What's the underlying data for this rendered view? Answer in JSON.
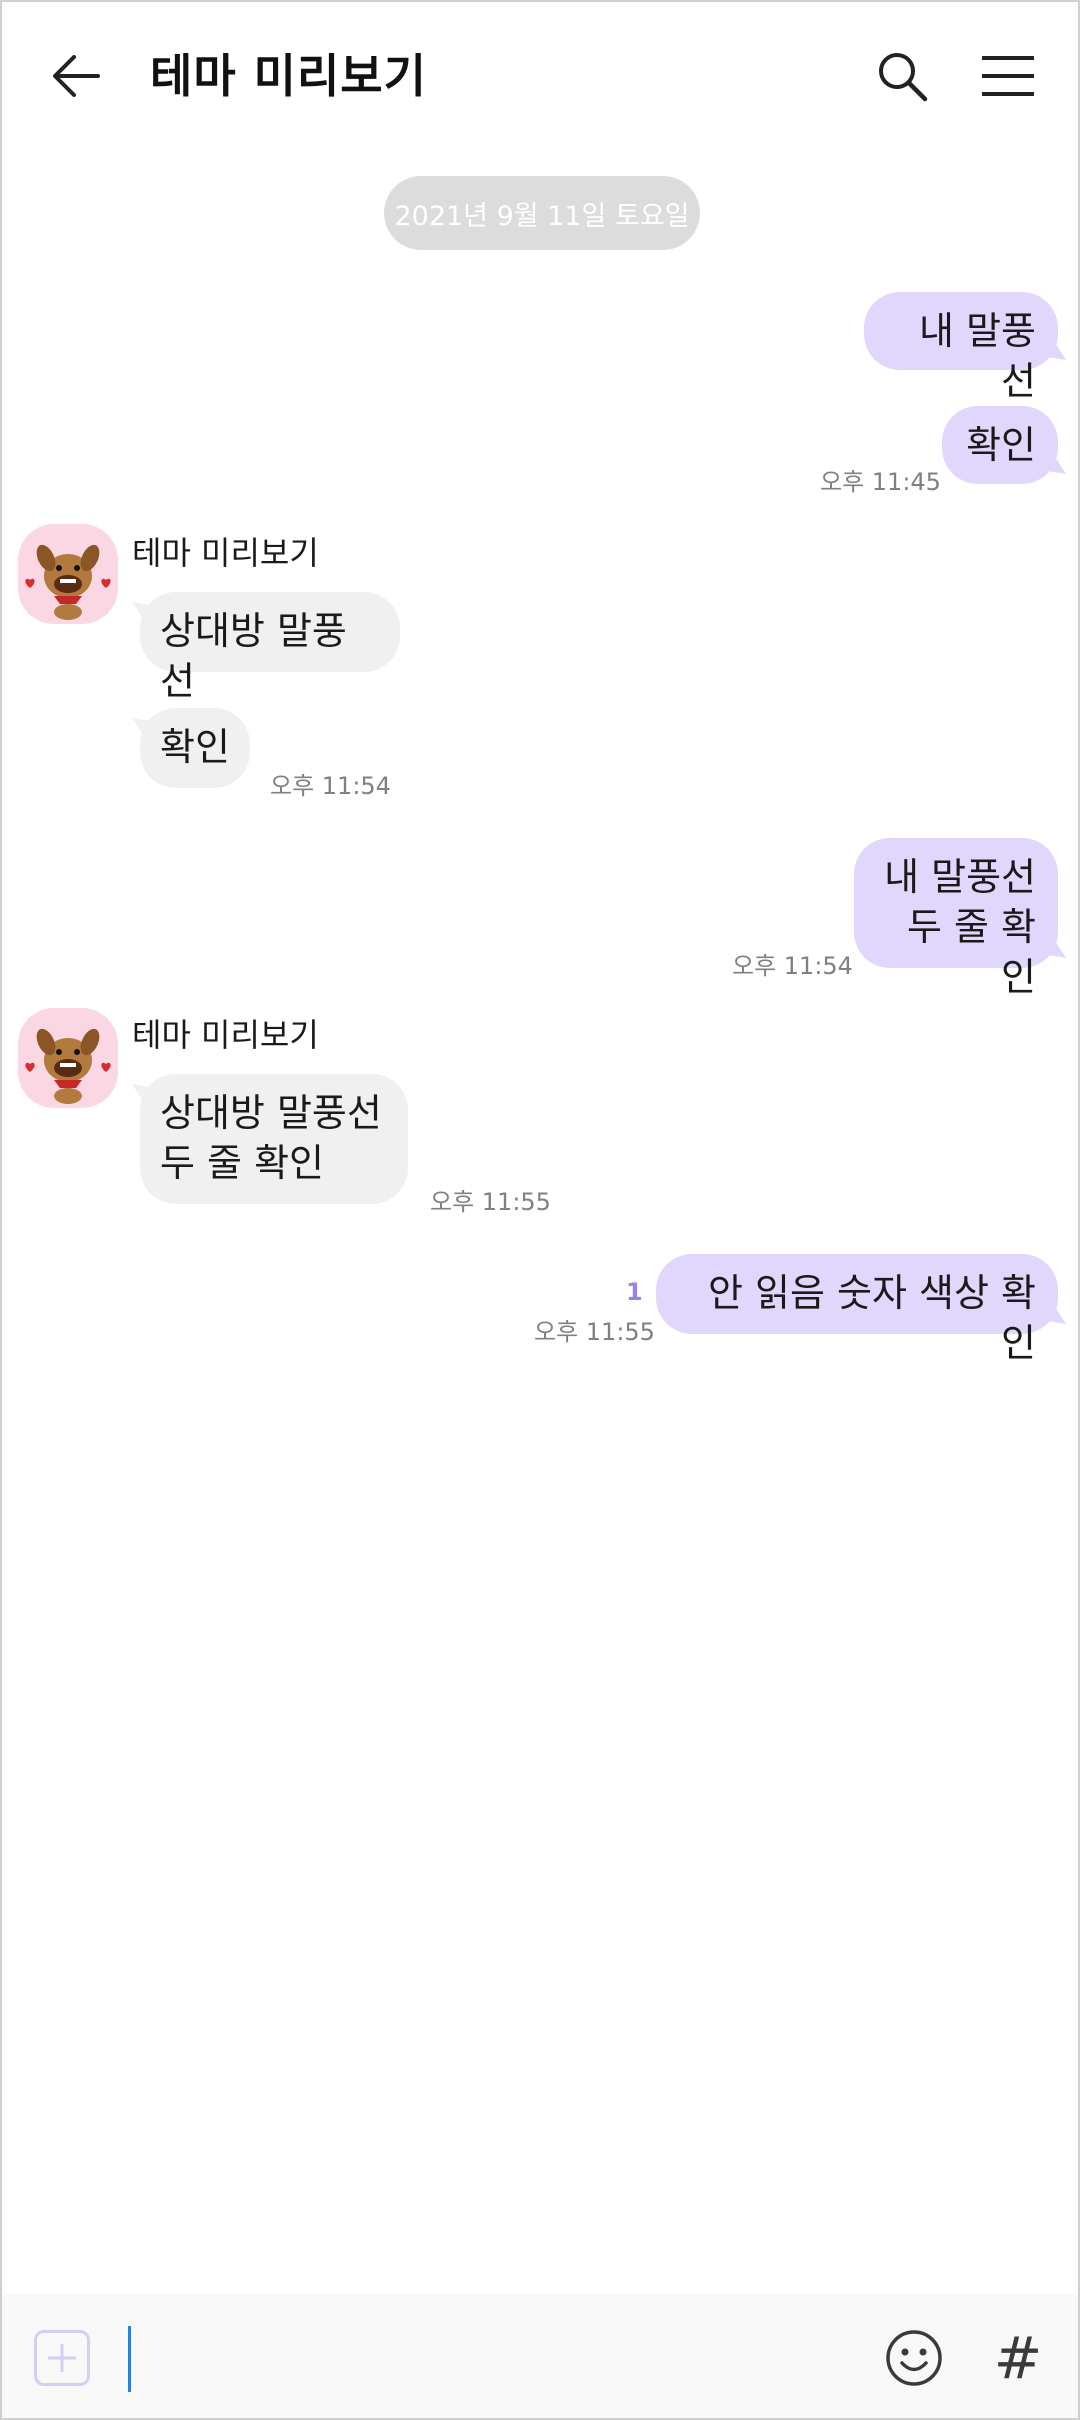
{
  "header": {
    "title": "테마 미리보기",
    "back_icon": "arrow-left-icon",
    "search_icon": "search-icon",
    "menu_icon": "hamburger-menu-icon"
  },
  "date_divider": "2021년 9월 11일 토요일",
  "colors": {
    "my_bubble": "#e1d6fb",
    "other_bubble": "#f0f0f0",
    "unread": "#9b83e6",
    "avatar_bg": "#fbd7e3"
  },
  "messages": [
    {
      "side": "me",
      "text": "내 말풍선",
      "time": ""
    },
    {
      "side": "me",
      "text": "확인",
      "time": "오후 11:45"
    },
    {
      "side": "other",
      "sender": "테마 미리보기",
      "text": "상대방 말풍선",
      "time": ""
    },
    {
      "side": "other",
      "text": "확인",
      "time": "오후 11:54"
    },
    {
      "side": "me",
      "text": "내 말풍선\n두 줄 확인",
      "time": "오후 11:54"
    },
    {
      "side": "other",
      "sender": "테마 미리보기",
      "text": "상대방 말풍선\n두 줄 확인",
      "time": "오후 11:55"
    },
    {
      "side": "me",
      "text": "안 읽음 숫자 색상 확인",
      "time": "오후 11:55",
      "unread": "1"
    }
  ],
  "input_bar": {
    "plus_icon": "plus-icon",
    "emoji_icon": "emoji-smile-icon",
    "hash_symbol": "#"
  }
}
